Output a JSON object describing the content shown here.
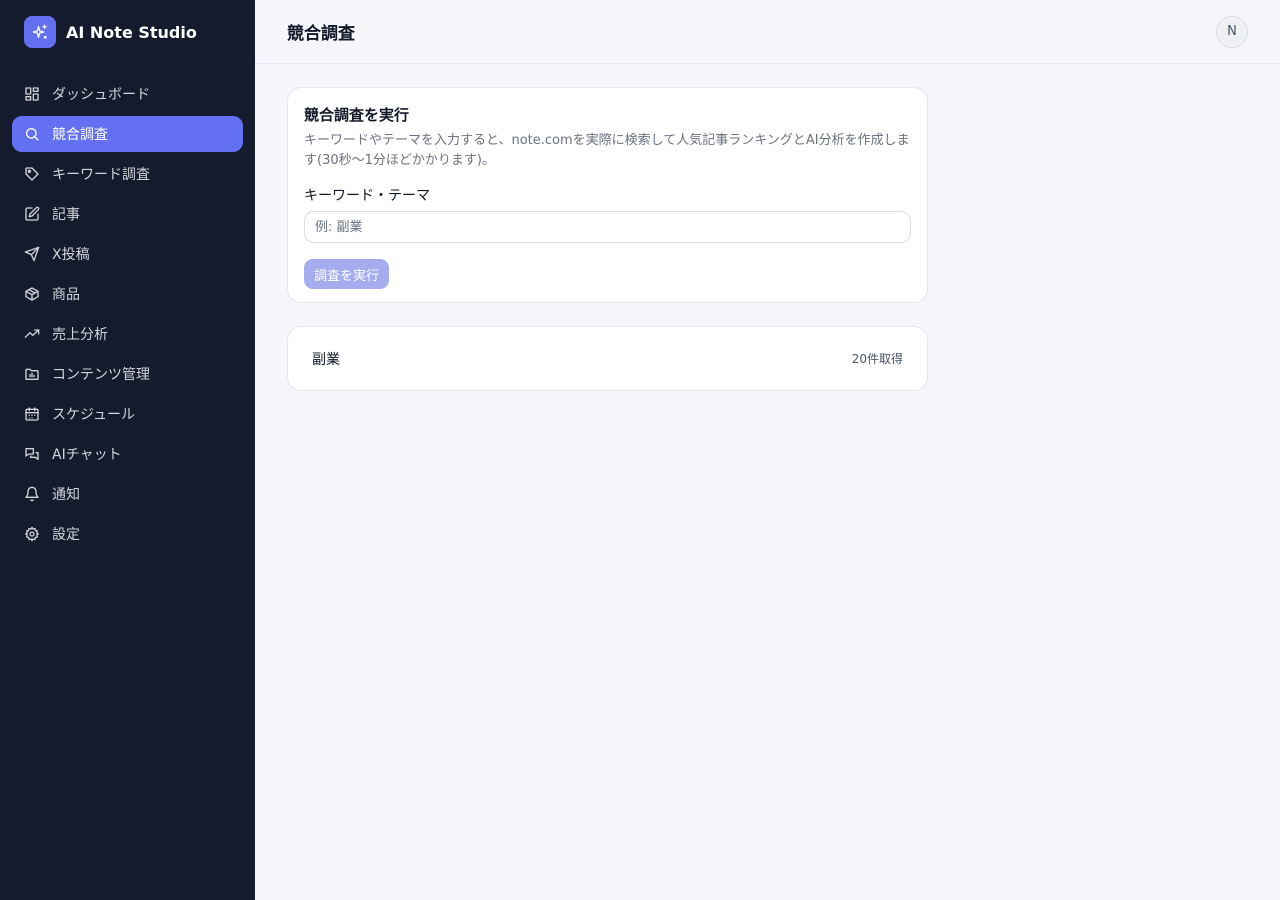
{
  "app": {
    "name": "AI Note Studio"
  },
  "sidebar": {
    "items": [
      {
        "label": "ダッシュボード",
        "icon": "grid-icon",
        "active": false
      },
      {
        "label": "競合調査",
        "icon": "search-icon",
        "active": true
      },
      {
        "label": "キーワード調査",
        "icon": "tag-icon",
        "active": false
      },
      {
        "label": "記事",
        "icon": "edit-icon",
        "active": false
      },
      {
        "label": "X投稿",
        "icon": "send-icon",
        "active": false
      },
      {
        "label": "商品",
        "icon": "box-icon",
        "active": false
      },
      {
        "label": "売上分析",
        "icon": "trending-up-icon",
        "active": false
      },
      {
        "label": "コンテンツ管理",
        "icon": "folder-chart-icon",
        "active": false
      },
      {
        "label": "スケジュール",
        "icon": "calendar-icon",
        "active": false
      },
      {
        "label": "AIチャット",
        "icon": "chat-icon",
        "active": false
      },
      {
        "label": "通知",
        "icon": "bell-icon",
        "active": false
      },
      {
        "label": "設定",
        "icon": "gear-icon",
        "active": false
      }
    ]
  },
  "header": {
    "title": "競合調査",
    "avatar_initial": "N"
  },
  "research": {
    "title": "競合調査を実行",
    "description": "キーワードやテーマを入力すると、note.comを実際に検索して人気記事ランキングとAI分析を作成します(30秒〜1分ほどかかります)。",
    "field_label": "キーワード・テーマ",
    "input_value": "",
    "input_placeholder": "例: 副業",
    "run_label": "調査を実行"
  },
  "results": [
    {
      "keyword": "副業",
      "count": "20件取得"
    }
  ],
  "colors": {
    "sidebar_bg": "#141b2d",
    "accent": "#6370f2",
    "button_disabled": "#a6acf0",
    "page_bg": "#f4f6fa"
  }
}
